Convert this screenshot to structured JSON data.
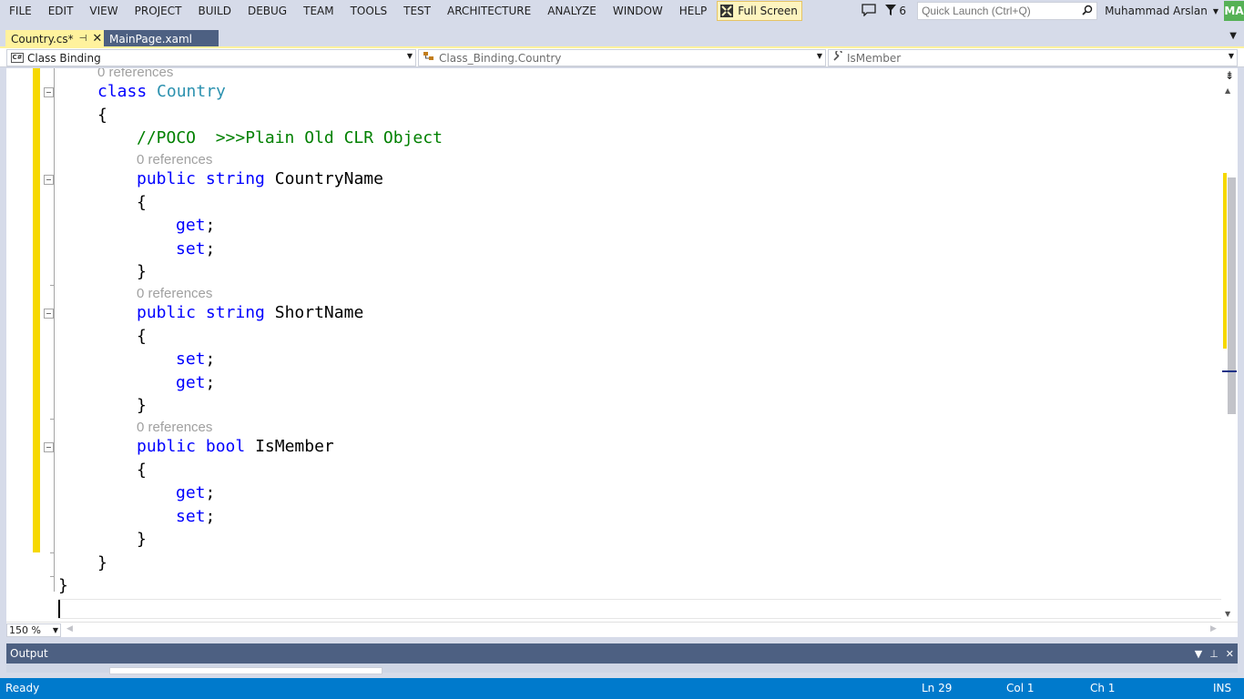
{
  "menu": {
    "items": [
      "FILE",
      "EDIT",
      "VIEW",
      "PROJECT",
      "BUILD",
      "DEBUG",
      "TEAM",
      "TOOLS",
      "TEST",
      "ARCHITECTURE",
      "ANALYZE",
      "WINDOW",
      "HELP"
    ],
    "fullscreen_label": "Full Screen",
    "filter_count": "6",
    "quick_launch_placeholder": "Quick Launch (Ctrl+Q)",
    "user_name": "Muhammad Arslan",
    "avatar_initials": "MA"
  },
  "tabs": [
    {
      "label": "Country.cs*",
      "active": true
    },
    {
      "label": "MainPage.xaml",
      "active": false
    }
  ],
  "navbar": {
    "project": "Class Binding",
    "type": "Class_Binding.Country",
    "member": "IsMember"
  },
  "editor": {
    "references_label": "0 references",
    "lines": {
      "class_kw": "class",
      "class_name": "Country",
      "open_brace": "{",
      "close_brace": "}",
      "comment": "//POCO  >>>Plain Old CLR Object",
      "public_kw": "public",
      "string_kw": "string",
      "bool_kw": "bool",
      "prop1": "CountryName",
      "prop2": "ShortName",
      "prop3": "IsMember",
      "get_kw": "get",
      "set_kw": "set",
      "semicolon": ";"
    }
  },
  "zoom": "150 %",
  "output": {
    "title": "Output"
  },
  "status": {
    "ready": "Ready",
    "line": "Ln 29",
    "col": "Col 1",
    "ch": "Ch 1",
    "mode": "INS"
  },
  "colors": {
    "accent": "#007acc",
    "keyword": "#0000ff",
    "type": "#2b91af",
    "comment": "#008000",
    "change_margin": "#f6d800",
    "tab_active": "#fff29d"
  }
}
